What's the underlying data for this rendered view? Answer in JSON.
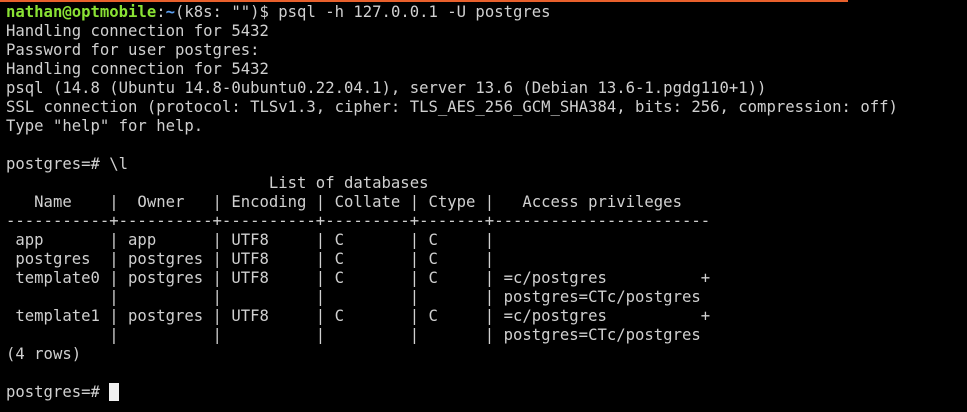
{
  "prompt": {
    "user_host": "nathan@optmobile",
    "separator": ":",
    "path": "~",
    "suffix": "(k8s: \"\")$ ",
    "command": "psql -h 127.0.0.1 -U postgres"
  },
  "output": {
    "line1": "Handling connection for 5432",
    "line2": "Password for user postgres:",
    "line3": "Handling connection for 5432",
    "line4": "psql (14.8 (Ubuntu 14.8-0ubuntu0.22.04.1), server 13.6 (Debian 13.6-1.pgdg110+1))",
    "line5": "SSL connection (protocol: TLSv1.3, cipher: TLS_AES_256_GCM_SHA384, bits: 256, compression: off)",
    "line6": "Type \"help\" for help."
  },
  "psql": {
    "prompt1": "postgres=# ",
    "command1": "\\l",
    "table_title": "                            List of databases",
    "header_row": "   Name    |  Owner   | Encoding | Collate | Ctype |   Access privileges",
    "separator_row": "-----------+----------+----------+---------+-------+-----------------------",
    "rows": [
      " app       | app      | UTF8     | C       | C     |",
      " postgres  | postgres | UTF8     | C       | C     |",
      " template0 | postgres | UTF8     | C       | C     | =c/postgres          +",
      "           |          |          |         |       | postgres=CTc/postgres",
      " template1 | postgres | UTF8     | C       | C     | =c/postgres          +",
      "           |          |          |         |       | postgres=CTc/postgres"
    ],
    "row_count": "(4 rows)",
    "prompt2": "postgres=# "
  },
  "colors": {
    "background": "#000000",
    "text": "#d0d0d0",
    "user_host": "#8ae234",
    "path": "#5c9ff0",
    "accent_bar": "#e8602c"
  }
}
